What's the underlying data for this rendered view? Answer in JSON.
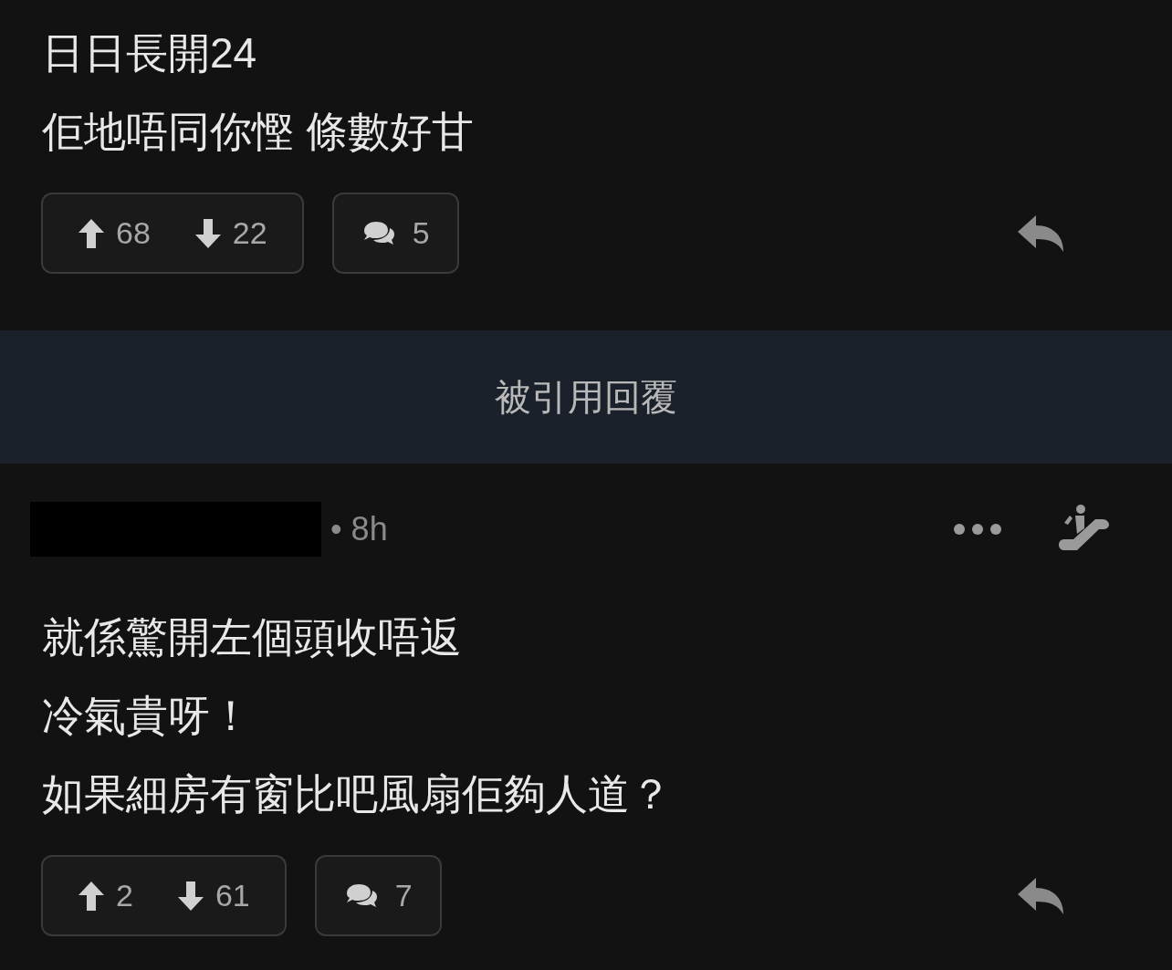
{
  "posts": [
    {
      "kind": "top",
      "lines": [
        "日日長開24",
        "佢地唔同你慳 條數好甘"
      ],
      "upvotes": "68",
      "downvotes": "22",
      "comments": "5"
    },
    {
      "kind": "header",
      "title": "被引用回覆"
    },
    {
      "kind": "reply",
      "time": "• 8h",
      "lines": [
        "就係驚開左個頭收唔返",
        "冷氣貴呀！",
        "如果細房有窗比吧風扇佢夠人道？"
      ],
      "upvotes": "2",
      "downvotes": "61",
      "comments": "7"
    }
  ]
}
